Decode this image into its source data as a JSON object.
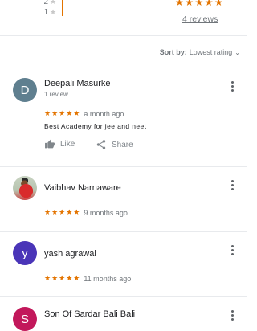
{
  "histogram": {
    "rows": [
      {
        "label": "2"
      },
      {
        "label": "1"
      }
    ]
  },
  "summary": {
    "stars": "★★★★★",
    "reviews_link": "4 reviews"
  },
  "sort": {
    "prefix": "Sort by:",
    "value": "Lowest rating"
  },
  "colors": {
    "accent": "#e37400",
    "purple": "#4a35b8",
    "pink": "#c2185b",
    "slate": "#5f7f8f"
  },
  "reviews": [
    {
      "initial": "D",
      "avatar_color": "#5f7f8f",
      "name": "Deepali Masurke",
      "subtitle": "1 review",
      "stars": "★★★★★",
      "time": "a month ago",
      "text": "Best Academy for jee and neet",
      "like_label": "Like",
      "share_label": "Share"
    },
    {
      "initial": "",
      "avatar_type": "photo",
      "name": "Vaibhav Narnaware",
      "stars": "★★★★★",
      "time": "9 months ago"
    },
    {
      "initial": "y",
      "avatar_color": "#4a35b8",
      "name": "yash agrawal",
      "stars": "★★★★★",
      "time": "11 months ago"
    },
    {
      "initial": "S",
      "avatar_color": "#c2185b",
      "name": "Son Of Sardar Bali Bali"
    }
  ]
}
